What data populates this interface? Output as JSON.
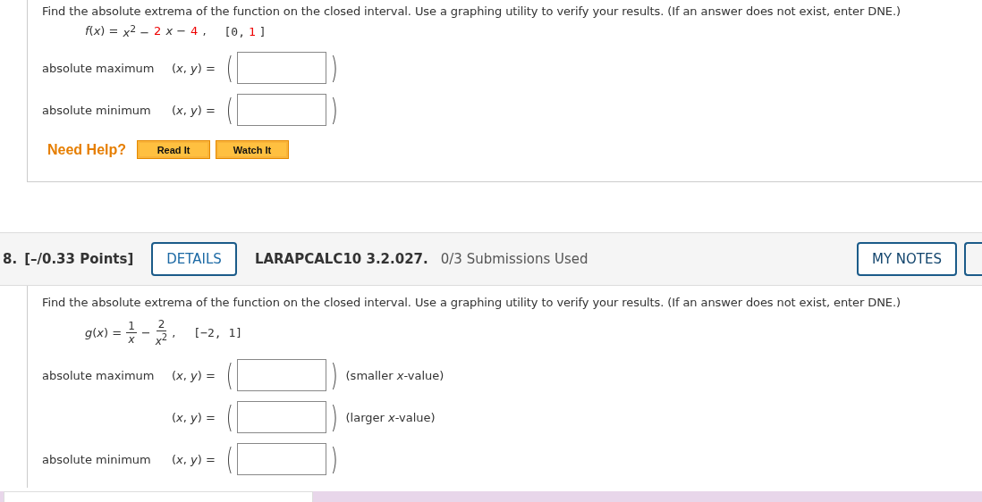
{
  "questions": [
    {
      "instruction": "Find the absolute extrema of the function on the closed interval. Use a graphing utility to verify your results. (If an answer does not exist, enter DNE.)",
      "formula": {
        "lhs": "*f*(*x*) =",
        "terms": [
          {
            "kind": "text",
            "text": "*x*$^{2}$ −"
          },
          {
            "kind": "param",
            "text": "2"
          },
          {
            "kind": "text",
            "text": "*x* −"
          },
          {
            "kind": "param",
            "text": "4"
          },
          {
            "kind": "text",
            "text": ","
          }
        ],
        "interval": [
          {
            "kind": "text",
            "text": "[0,"
          },
          {
            "kind": "param",
            "text": "1"
          },
          {
            "kind": "text",
            "text": "]"
          }
        ]
      },
      "rows": [
        {
          "label": "absolute maximum",
          "prefix": "(*x*, *y*) =",
          "open": "(",
          "close": ")"
        },
        {
          "label": "absolute minimum",
          "prefix": "(*x*, *y*) =",
          "open": "(",
          "close": ")"
        }
      ],
      "help": {
        "label": "Need Help?",
        "buttons": [
          "Read It",
          "Watch It"
        ]
      }
    },
    {
      "header": {
        "number": "8.",
        "points": "[–/0.33 Points]",
        "details": "DETAILS",
        "code": "LARAPCALC10 3.2.027.",
        "submissions": "0/3 Submissions Used",
        "notes": "MY NOTES"
      },
      "instruction": "Find the absolute extrema of the function on the closed interval. Use a graphing utility to verify your results. (If an answer does not exist, enter DNE.)",
      "formula": {
        "lhs": "*g*(*x*) =",
        "terms": [
          {
            "kind": "fraction",
            "numerator": "1",
            "denominator": "*x*"
          },
          {
            "kind": "text",
            "text": "−"
          },
          {
            "kind": "fraction",
            "numerator": "2",
            "denominator": "*x*$^{2}$"
          },
          {
            "kind": "text",
            "text": ","
          }
        ],
        "interval": [
          {
            "kind": "text",
            "text": "[−2, 1]"
          }
        ]
      },
      "rows": [
        {
          "label": "absolute maximum",
          "prefix": "(*x*, *y*) =",
          "open": "(",
          "close": ")",
          "note": "(smaller *x*-value)"
        },
        {
          "prefix": "(*x*, *y*) =",
          "open": "(",
          "close": ")",
          "note": "(larger *x*-value)"
        },
        {
          "label": "absolute minimum",
          "prefix": "(*x*, *y*) =",
          "open": "(",
          "close": ")"
        }
      ]
    }
  ]
}
